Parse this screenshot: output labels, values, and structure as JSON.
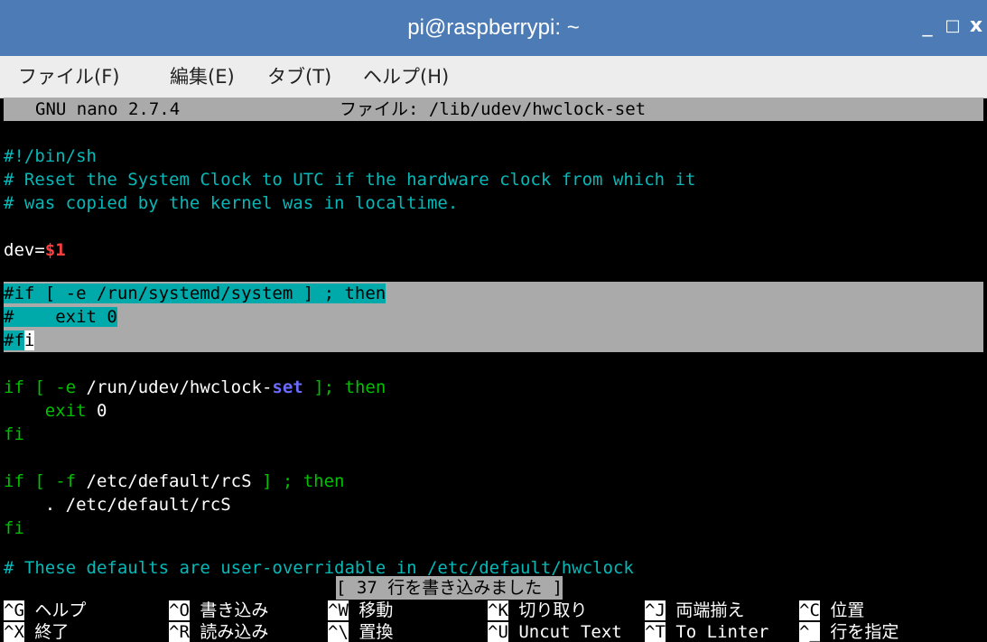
{
  "window": {
    "title": "pi@raspberrypi: ~",
    "minimize": "_",
    "maximize": "□",
    "close": "x"
  },
  "menu": {
    "items": [
      {
        "label": "ファイル(F)"
      },
      {
        "label": "編集(E)"
      },
      {
        "label": "タブ(T)"
      },
      {
        "label": "ヘルプ(H)"
      }
    ]
  },
  "nano": {
    "version": "GNU nano 2.7.4",
    "file_label": "ファイル: /lib/udev/hwclock-set",
    "lines": {
      "l1": "#!/bin/sh",
      "l2": "# Reset the System Clock to UTC if the hardware clock from which it",
      "l3": "# was copied by the kernel was in localtime.",
      "l5a": "dev=",
      "l5b": "$1",
      "l7": "#if [ -e /run/systemd/system ] ; then",
      "l8": "#    exit 0",
      "l9a": "#f",
      "l9b": "i",
      "l11a": "if [ -e ",
      "l11b": "/run/udev/hwclock-",
      "l11c": "set",
      "l11d": " ]; then",
      "l12a": "    exit ",
      "l12b": "0",
      "l13": "fi",
      "l15a": "if [ -f ",
      "l15b": "/etc/default/rcS",
      "l15c": " ] ; then",
      "l16": "    . /etc/default/rcS",
      "l17": "fi",
      "l19": "# These defaults are user-overridable in /etc/default/hwclock"
    },
    "message": "[ 37 行を書き込みました ]",
    "shortcuts": [
      {
        "key": "^G",
        "label": "ヘルプ"
      },
      {
        "key": "^O",
        "label": "書き込み"
      },
      {
        "key": "^W",
        "label": "移動"
      },
      {
        "key": "^K",
        "label": "切り取り"
      },
      {
        "key": "^J",
        "label": "両端揃え"
      },
      {
        "key": "^C",
        "label": "位置"
      },
      {
        "key": "^X",
        "label": "終了"
      },
      {
        "key": "^R",
        "label": "読み込み"
      },
      {
        "key": "^\\",
        "label": "置換"
      },
      {
        "key": "^U",
        "label": "Uncut Text"
      },
      {
        "key": "^T",
        "label": "To Linter"
      },
      {
        "key": "^_",
        "label": "行を指定"
      }
    ]
  },
  "colors": {
    "titlebar": "#4d7bb5",
    "comment": "#06b8b8",
    "keyword": "#00c000",
    "variable": "#ff3f3f",
    "builtin": "#6a6aff",
    "selection": "#00aaaa"
  }
}
